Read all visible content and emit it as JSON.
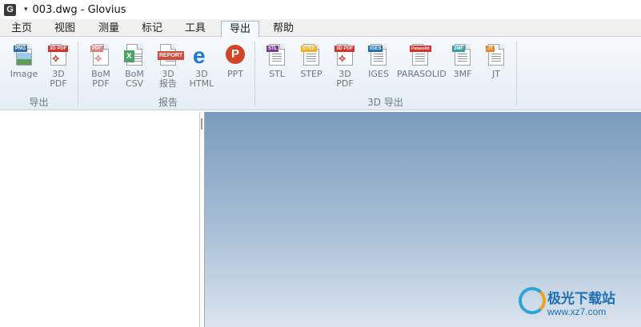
{
  "window": {
    "app_icon_letter": "G",
    "quick_access_glyph": "▾",
    "title": "003.dwg - Glovius"
  },
  "menu": {
    "tabs": [
      "主页",
      "视图",
      "测量",
      "标记",
      "工具",
      "导出",
      "帮助"
    ],
    "active_tab": "导出"
  },
  "ribbon": {
    "groups": [
      {
        "label": "导出"
      },
      {
        "label": "报告"
      },
      {
        "label": "3D 导出"
      }
    ],
    "buttons": [
      {
        "label": "Image",
        "tag": "PNG",
        "tag_color": "#2b6cb0",
        "icon": "png-image-icon"
      },
      {
        "label": "3D\nPDF",
        "tag": "3D PDF",
        "tag_color": "#d9302a",
        "icon": "pdf-icon"
      },
      {
        "label": "BoM\nPDF",
        "tag": "PDF",
        "tag_color": "#e07e7a",
        "icon": "pdf-icon"
      },
      {
        "label": "BoM\nCSV",
        "tag": "X",
        "tag_color": "#4aa564",
        "icon": "excel-csv-icon"
      },
      {
        "label": "3D\n报告",
        "tag": "REPORT",
        "tag_color": "#d24b3c",
        "icon": "report-icon"
      },
      {
        "label": "3D\nHTML",
        "tag": "e",
        "tag_color": "#1e78d2",
        "icon": "edge-html-icon"
      },
      {
        "label": "PPT",
        "tag": "P",
        "tag_color": "#d2452a",
        "icon": "powerpoint-icon"
      },
      {
        "label": "STL",
        "tag": "STL",
        "tag_color": "#7c3b9c",
        "icon": "stl-file-icon"
      },
      {
        "label": "STEP",
        "tag": "STEP",
        "tag_color": "#f0b21a",
        "icon": "step-file-icon"
      },
      {
        "label": "3D\nPDF",
        "tag": "3D PDF",
        "tag_color": "#d9302a",
        "icon": "pdf-icon"
      },
      {
        "label": "IGES",
        "tag": "IGES",
        "tag_color": "#1d6fb8",
        "icon": "iges-file-icon"
      },
      {
        "label": "PARASOLID",
        "tag": "Parasolid",
        "tag_color": "#d9302a",
        "icon": "parasolid-file-icon"
      },
      {
        "label": "3MF",
        "tag": "3MF",
        "tag_color": "#3aa0a8",
        "icon": "3mf-file-icon"
      },
      {
        "label": "JT",
        "tag": "JT",
        "tag_color": "#e8872a",
        "icon": "jt-file-icon"
      }
    ]
  },
  "watermark": {
    "brand": "极光下载站",
    "url": "www.xz7.com"
  }
}
